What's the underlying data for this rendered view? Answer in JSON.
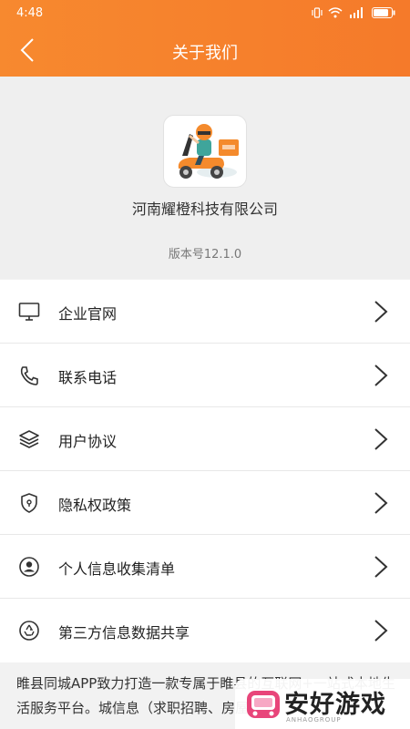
{
  "status_bar": {
    "time": "4:48"
  },
  "nav": {
    "title": "关于我们"
  },
  "about": {
    "company": "河南耀橙科技有限公司",
    "version": "版本号12.1.0"
  },
  "menu": [
    {
      "label": "企业官网",
      "icon": "monitor-icon"
    },
    {
      "label": "联系电话",
      "icon": "phone-icon"
    },
    {
      "label": "用户协议",
      "icon": "layers-icon"
    },
    {
      "label": "隐私权政策",
      "icon": "shield-icon"
    },
    {
      "label": "个人信息收集清单",
      "icon": "user-circle-icon"
    },
    {
      "label": "第三方信息数据共享",
      "icon": "recycle-icon"
    }
  ],
  "description": "睢县同城APP致力打造一款专属于睢县的互联网+一站式本地生活服务平台。城信息（求职招聘、房屋租售",
  "watermark": {
    "title": "安好游戏",
    "subtitle": "ANHAOGROUP"
  },
  "colors": {
    "header": "#f7892f",
    "background": "#f2f2f2"
  }
}
